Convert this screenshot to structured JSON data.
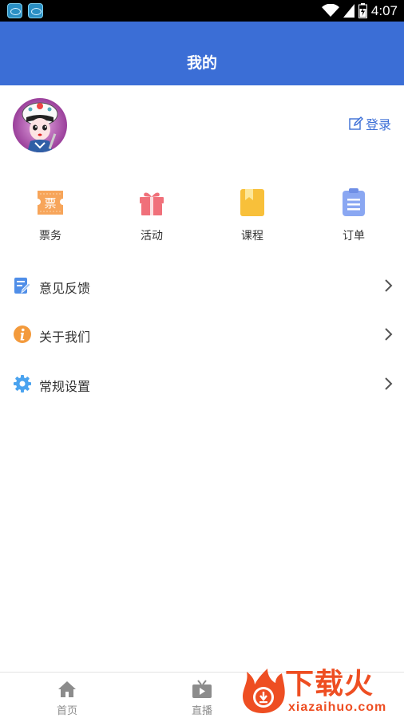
{
  "status_bar": {
    "time": "4:07",
    "notification_icons": [
      "app-notification-icon",
      "app-notification-icon"
    ],
    "battery_level": 0.7
  },
  "header": {
    "title": "我的"
  },
  "profile": {
    "login_label": "登录"
  },
  "quick_links": [
    {
      "label": "票务",
      "icon": "ticket-icon",
      "icon_text": "票",
      "color": "#f7a55a"
    },
    {
      "label": "活动",
      "icon": "gift-icon",
      "color": "#f0707a"
    },
    {
      "label": "课程",
      "icon": "course-book-icon",
      "color": "#f8c03a"
    },
    {
      "label": "订单",
      "icon": "order-clipboard-icon",
      "color": "#8aa7f2"
    }
  ],
  "menu": [
    {
      "label": "意见反馈",
      "icon": "feedback-icon",
      "color": "#4f8ee8"
    },
    {
      "label": "关于我们",
      "icon": "info-icon",
      "color": "#f39a3c"
    },
    {
      "label": "常规设置",
      "icon": "settings-gear-icon",
      "color": "#4aa3ef"
    }
  ],
  "tab_bar": [
    {
      "label": "首页",
      "icon": "home-icon"
    },
    {
      "label": "直播",
      "icon": "live-tv-icon"
    }
  ],
  "watermark": {
    "brand": "下载火",
    "url": "xiazaihuo.com",
    "color": "#ee4e22"
  },
  "colors": {
    "accent": "#3b6ed6"
  }
}
